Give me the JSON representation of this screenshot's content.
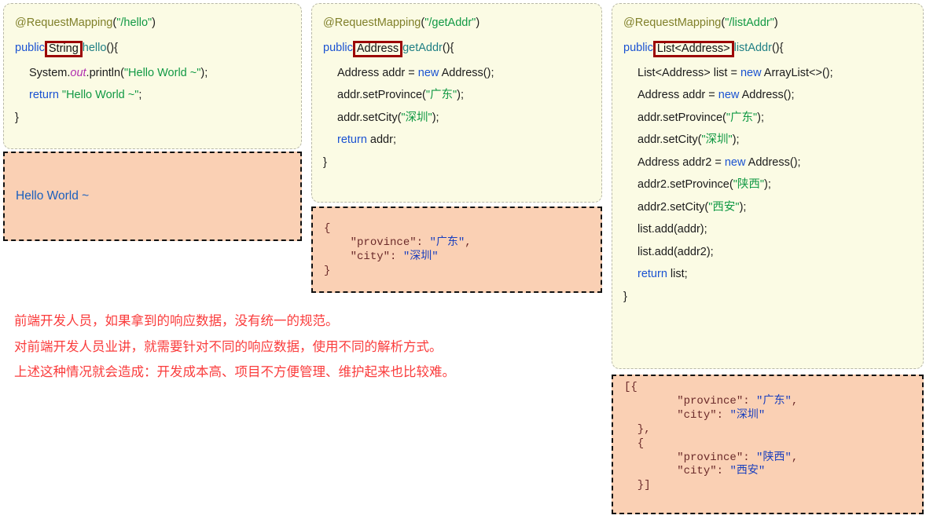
{
  "colors": {
    "card_bg": "#fbfbe4",
    "card_border": "#b8b8a8",
    "output_bg": "#fad0b4",
    "output_border": "#111111",
    "highlight_box": "#9c0505",
    "keyword": "#1a52d2",
    "annotation": "#80802a",
    "string": "#119944",
    "method": "#1f7f84",
    "static_field": "#b030b0",
    "note_red": "#fa3c3c",
    "json_key": "#8b2020",
    "json_value": "#1a3fbe"
  },
  "cards": [
    {
      "id": "hello",
      "mapping_annotation": "@RequestMapping",
      "mapping_path": "\"/hello\"",
      "signature": {
        "modifier": "public",
        "return_type": "String",
        "method_name": "hello",
        "tail": "(){"
      },
      "lines": [
        "System.out.println(\"Hello World ~\");",
        "return \"Hello World ~\";"
      ],
      "closing_brace": "}",
      "body": {
        "print_head": "System.",
        "print_field": "out",
        "print_mid": ".println(",
        "print_str": "\"Hello World ~\"",
        "print_tail": ");",
        "return_kw": "return",
        "return_str": "\"Hello World ~\"",
        "return_tail": ";"
      }
    },
    {
      "id": "getAddr",
      "mapping_annotation": "@RequestMapping",
      "mapping_path": "\"/getAddr\"",
      "signature": {
        "modifier": "public",
        "return_type": "Address",
        "method_name": "getAddr",
        "tail": "(){"
      },
      "body": {
        "l1_pre": "Address addr = ",
        "l1_kw": "new",
        "l1_post": " Address();",
        "l2_pre": "addr.setProvince(",
        "l2_str": "\"广东\"",
        "l2_post": ");",
        "l3_pre": "addr.setCity(",
        "l3_str": "\"深圳\"",
        "l3_post": ");",
        "l4_kw": "return",
        "l4_post": " addr;"
      },
      "closing_brace": "}"
    },
    {
      "id": "listAddr",
      "mapping_annotation": "@RequestMapping",
      "mapping_path": "\"/listAddr\"",
      "signature": {
        "modifier": "public",
        "return_type": "List<Address>",
        "method_name": "listAddr",
        "tail": "(){"
      },
      "body": {
        "l1_pre": "List<Address> list = ",
        "l1_kw": "new",
        "l1_post": " ArrayList<>();",
        "l2_pre": "Address addr = ",
        "l2_kw": "new",
        "l2_post": " Address();",
        "l3_pre": "addr.setProvince(",
        "l3_str": "\"广东\"",
        "l3_post": ");",
        "l4_pre": "addr.setCity(",
        "l4_str": "\"深圳\"",
        "l4_post": ");",
        "l5_pre": "Address addr2 = ",
        "l5_kw": "new",
        "l5_post": " Address();",
        "l6_pre": "addr2.setProvince(",
        "l6_str": "\"陕西\"",
        "l6_post": ");",
        "l7_pre": "addr2.setCity(",
        "l7_str": "\"西安\"",
        "l7_post": ");",
        "l8": "list.add(addr);",
        "l9": "list.add(addr2);",
        "l10_kw": "return",
        "l10_post": " list;"
      },
      "closing_brace": "}"
    }
  ],
  "outputs": [
    {
      "id": "hello-output",
      "kind": "plain",
      "text": "Hello World ~"
    },
    {
      "id": "getAddr-output",
      "kind": "json",
      "lines": [
        {
          "indent": 0,
          "open": "{"
        },
        {
          "indent": 1,
          "key": "″province″",
          "colon": ": ",
          "value": "″广东″",
          "comma": ","
        },
        {
          "indent": 1,
          "key": "″city″",
          "colon": ": ",
          "value": "″深圳″",
          "comma": ""
        },
        {
          "indent": 0,
          "open": "}"
        }
      ]
    },
    {
      "id": "listAddr-output",
      "kind": "json",
      "lines": [
        {
          "indent": 0,
          "open": "[{"
        },
        {
          "indent": 2,
          "key": "″province″",
          "colon": ": ",
          "value": "″广东″",
          "comma": ","
        },
        {
          "indent": 2,
          "key": "″city″",
          "colon": ": ",
          "value": "″深圳″",
          "comma": ""
        },
        {
          "indent": 0,
          "open": "  },"
        },
        {
          "indent": 0,
          "open": "  {"
        },
        {
          "indent": 2,
          "key": "″province″",
          "colon": ": ",
          "value": "″陕西″",
          "comma": ","
        },
        {
          "indent": 2,
          "key": "″city″",
          "colon": ": ",
          "value": "″西安″",
          "comma": ""
        },
        {
          "indent": 0,
          "open": "  }]"
        }
      ]
    }
  ],
  "note": {
    "line1": "前端开发人员，如果拿到的响应数据，没有统一的规范。",
    "line2": "对前端开发人员业讲，就需要针对不同的响应数据，使用不同的解析方式。",
    "line3": "上述这种情况就会造成：开发成本高、项目不方便管理、维护起来也比较难。"
  }
}
